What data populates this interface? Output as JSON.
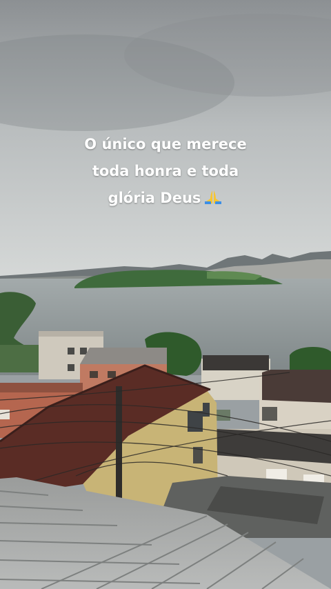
{
  "caption": {
    "line1": "O único que merece",
    "line2": "toda honra e toda",
    "line3": "glória Deus",
    "emoji": "praying-hands-icon"
  },
  "colors": {
    "sky_top": "#8e9295",
    "sky_bottom": "#d3d6d6",
    "water": "#8f9798",
    "island": "#3f6b3c"
  }
}
